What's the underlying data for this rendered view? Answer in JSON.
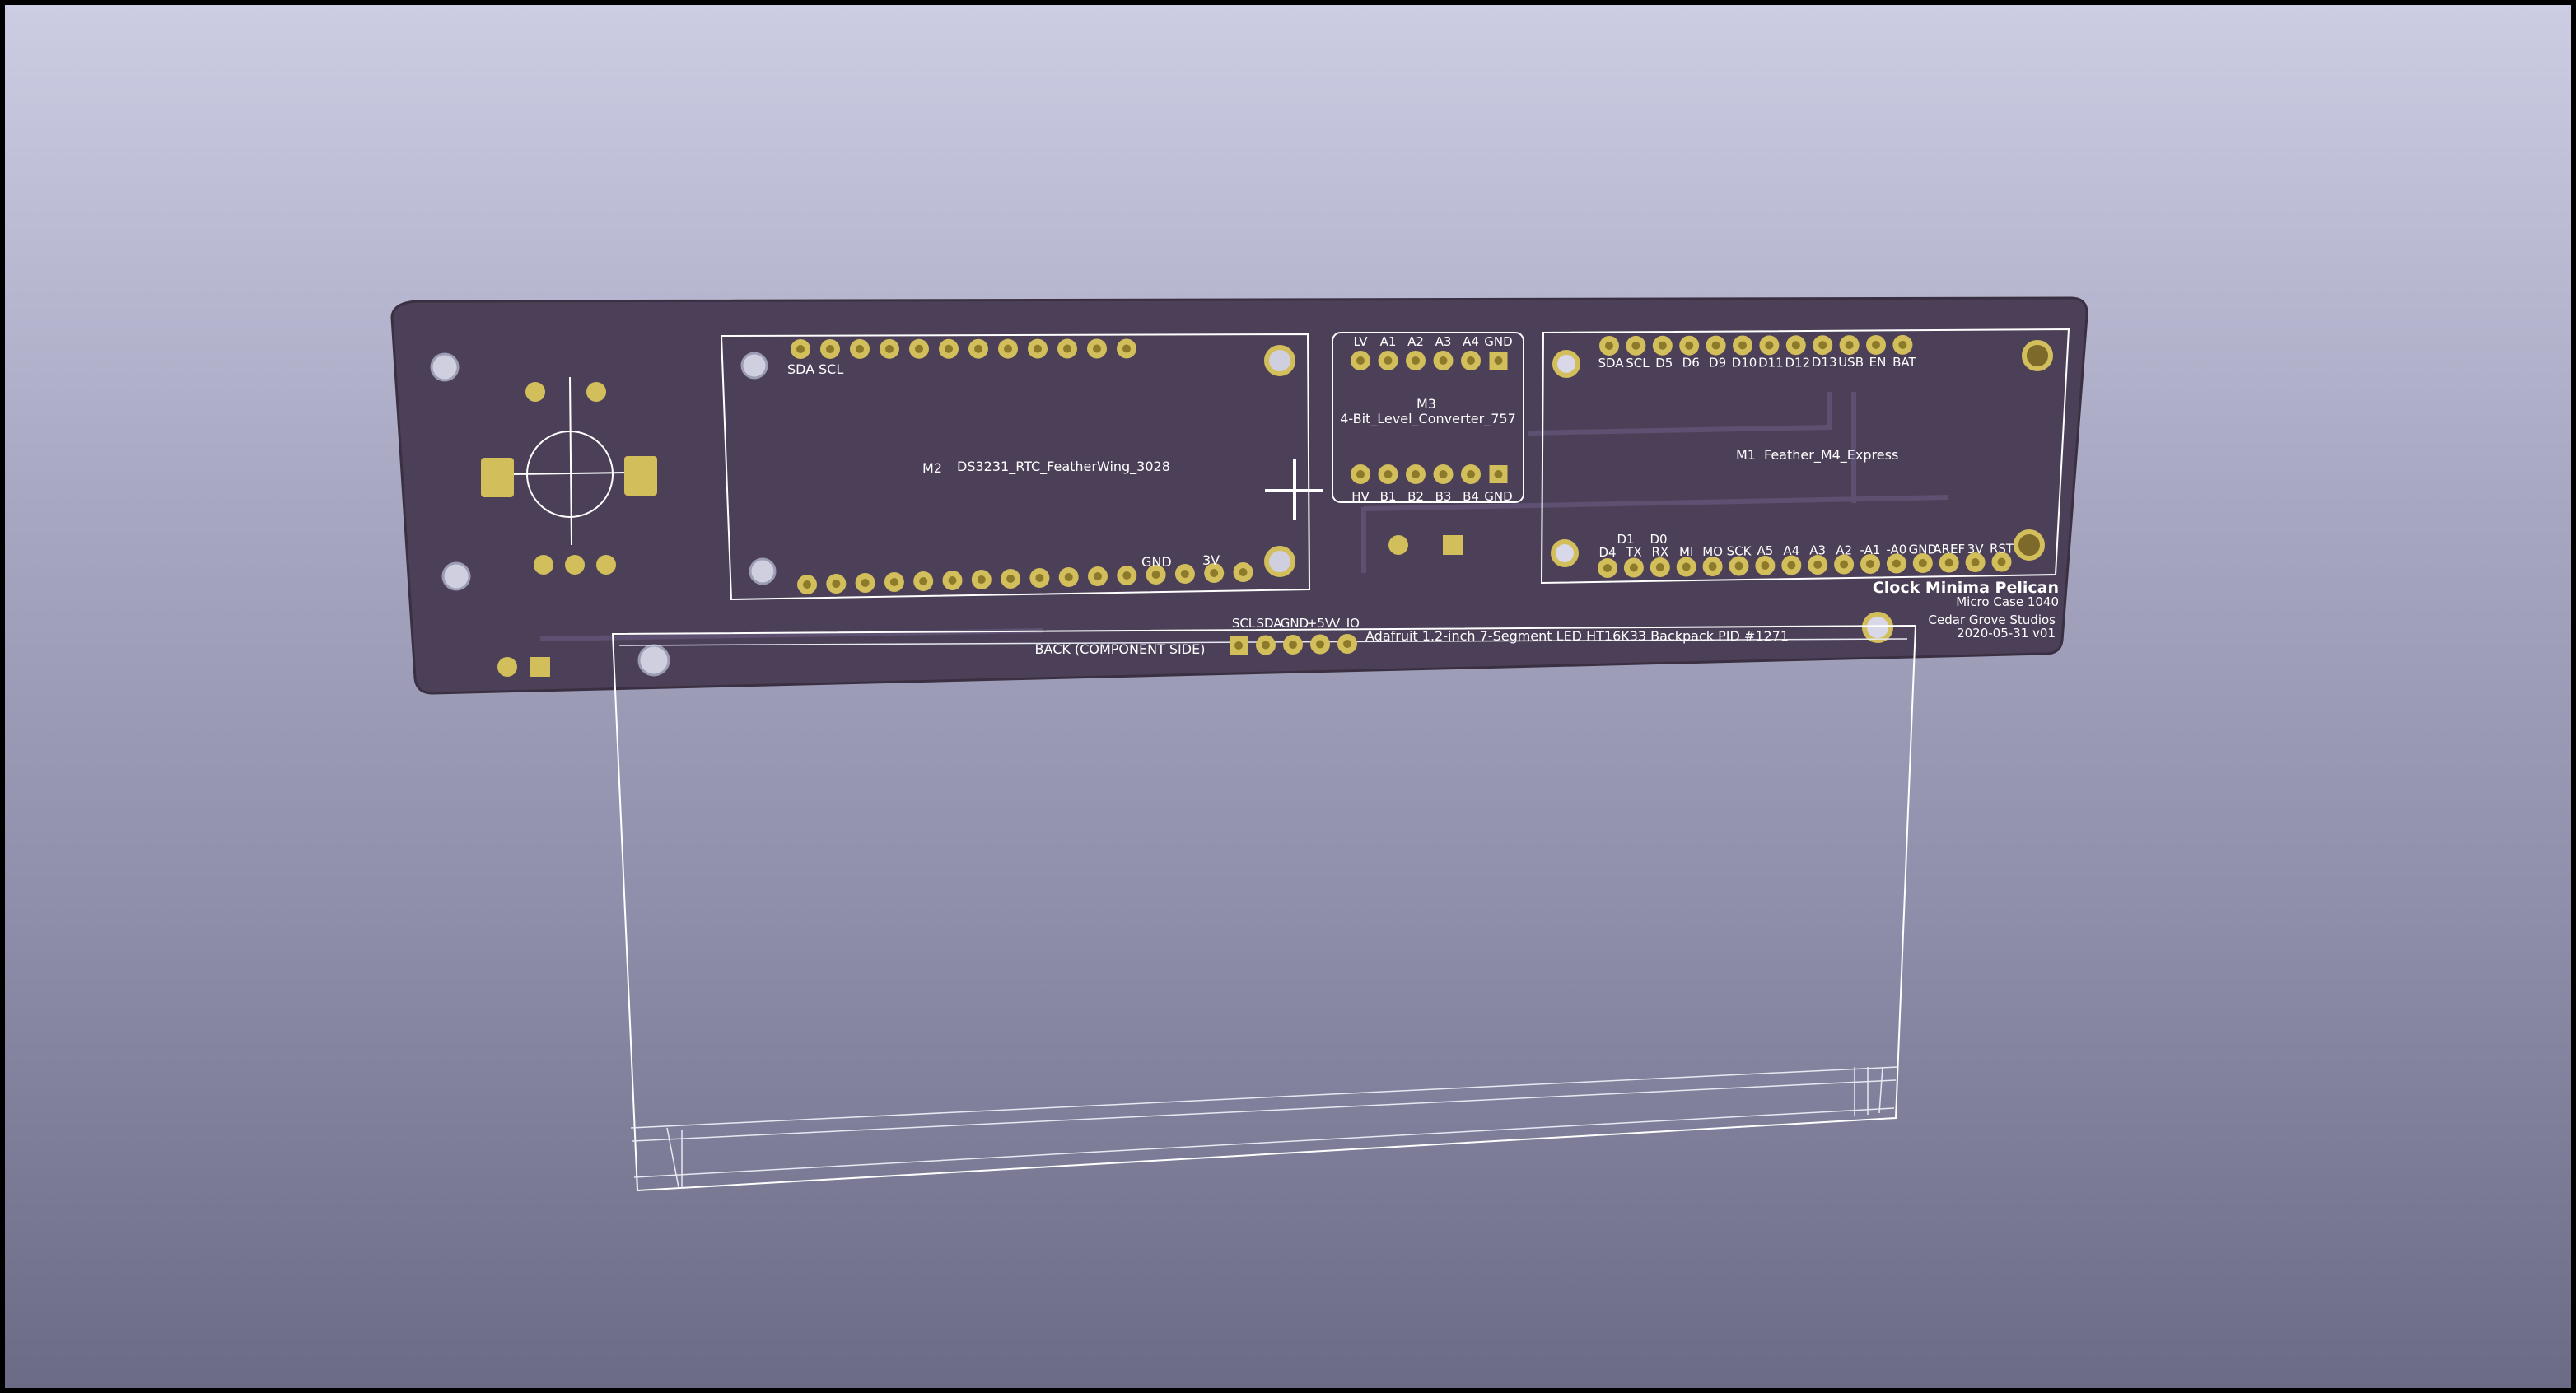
{
  "colors": {
    "board": "#4c4058",
    "board_edge": "#3a3042",
    "pad_gold": "#d2be5a",
    "pad_hole": "#8c7a2a",
    "silkscreen": "#ffffff",
    "mount_hole": "#cfcfe0"
  },
  "board": {
    "title": "Clock Minima Pelican",
    "case": "Micro Case 1040",
    "company": "Cedar Grove Studios",
    "version": "2020-05-31 v01",
    "back_label": "BACK (COMPONENT SIDE)"
  },
  "modules": {
    "m2": {
      "ref": "M2",
      "name": "DS3231_RTC_FeatherWing_3028",
      "pin_sda": "SDA",
      "pin_scl": "SCL",
      "pin_gnd": "GND",
      "pin_3v": "3V"
    },
    "m3": {
      "ref": "M3",
      "name": "4-Bit_Level_Converter_757",
      "top_pins": [
        "LV",
        "A1",
        "A2",
        "A3",
        "A4",
        "GND"
      ],
      "bottom_pins": [
        "HV",
        "B1",
        "B2",
        "B3",
        "B4",
        "GND"
      ]
    },
    "m1": {
      "ref": "M1",
      "name": "Feather_M4_Express",
      "top_pins": [
        "SDA",
        "SCL",
        "D5",
        "D6",
        "D9",
        "D10",
        "D11",
        "D12",
        "D13",
        "USB",
        "EN",
        "BAT"
      ],
      "bottom_pins": [
        "D4",
        "TX",
        "RX",
        "MI",
        "MO",
        "SCK",
        "A5",
        "A4",
        "A3",
        "A2",
        "-A1",
        "-A0",
        "GND",
        "AREF",
        "3V",
        "RST"
      ],
      "bottom_pins_upper": [
        "D1",
        "D0"
      ]
    },
    "display": {
      "name": "Adafruit 1.2-inch 7-Segment LED HT16K33 Backpack PID #1271",
      "pins": [
        "SCL",
        "SDA",
        "GND",
        "+5V",
        "V_IO"
      ]
    }
  }
}
